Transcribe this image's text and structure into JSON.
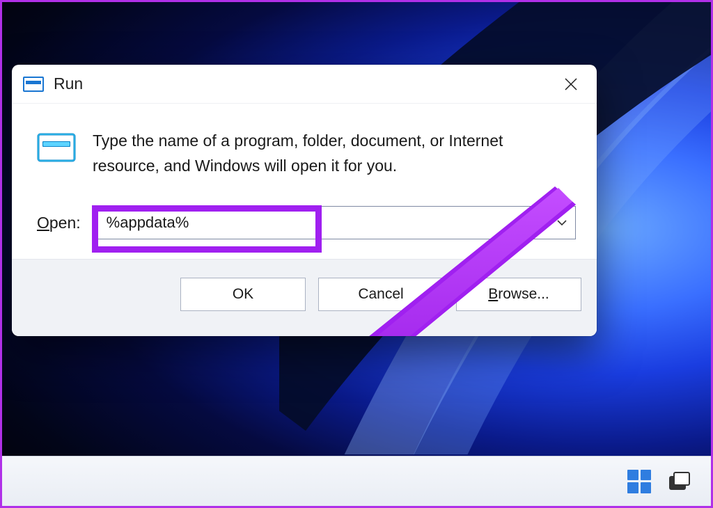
{
  "dialog": {
    "title": "Run",
    "description": "Type the name of a program, folder, document, or Internet resource, and Windows will open it for you.",
    "open_label_prefix": "O",
    "open_label_rest": "pen:",
    "input_value": "%appdata%",
    "buttons": {
      "ok": "OK",
      "cancel": "Cancel",
      "browse_prefix": "B",
      "browse_rest": "rowse..."
    }
  },
  "annotation": {
    "highlight_color": "#a020f0",
    "arrow_color": "#a020f0"
  }
}
